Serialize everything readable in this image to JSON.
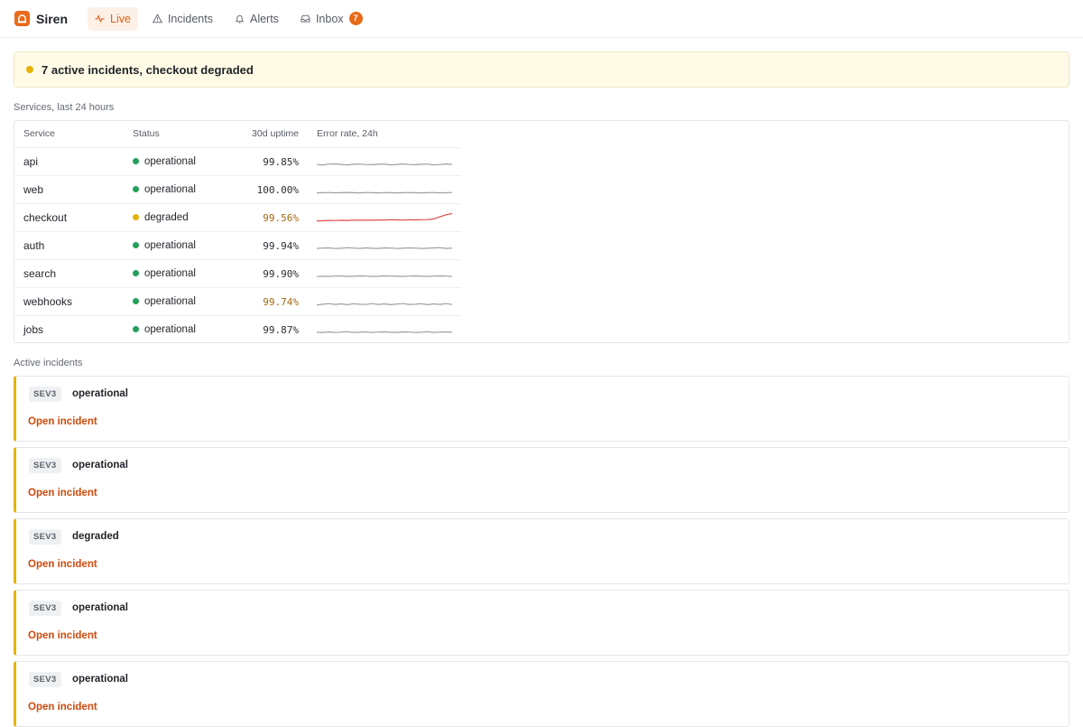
{
  "app": {
    "name": "Siren"
  },
  "nav": [
    {
      "label": "Live",
      "icon": "pulse-icon",
      "active": true
    },
    {
      "label": "Incidents",
      "icon": "warning-icon",
      "active": false
    },
    {
      "label": "Alerts",
      "icon": "bell-icon",
      "active": false
    },
    {
      "label": "Inbox",
      "icon": "inbox-icon",
      "active": false,
      "badge": "7"
    }
  ],
  "banner": {
    "text": "7 active incidents, checkout degraded",
    "color": "#e5b409"
  },
  "services": {
    "section_label": "Services, last 24 hours",
    "columns": [
      "Service",
      "Status",
      "30d uptime",
      "Error rate, 24h"
    ],
    "rows": [
      {
        "name": "api",
        "status": "operational",
        "uptime": "99.85%",
        "warn": false,
        "spark": [
          0.32,
          0.3,
          0.35,
          0.36,
          0.33,
          0.3,
          0.34,
          0.35,
          0.32,
          0.31,
          0.34,
          0.35,
          0.3,
          0.33,
          0.36,
          0.32,
          0.31,
          0.34,
          0.35,
          0.3,
          0.32,
          0.36,
          0.33
        ]
      },
      {
        "name": "web",
        "status": "operational",
        "uptime": "100.00%",
        "warn": false,
        "spark": [
          0.3,
          0.31,
          0.32,
          0.3,
          0.31,
          0.33,
          0.31,
          0.3,
          0.32,
          0.31,
          0.3,
          0.32,
          0.31,
          0.3,
          0.31,
          0.32,
          0.31,
          0.3,
          0.31,
          0.32,
          0.3,
          0.31,
          0.32
        ]
      },
      {
        "name": "checkout",
        "status": "degraded",
        "uptime": "99.56%",
        "warn": true,
        "spark": [
          0.3,
          0.31,
          0.33,
          0.32,
          0.34,
          0.33,
          0.35,
          0.34,
          0.35,
          0.34,
          0.36,
          0.35,
          0.37,
          0.36,
          0.35,
          0.37,
          0.36,
          0.37,
          0.38,
          0.42,
          0.55,
          0.68,
          0.75
        ]
      },
      {
        "name": "auth",
        "status": "operational",
        "uptime": "99.94%",
        "warn": false,
        "spark": [
          0.33,
          0.35,
          0.36,
          0.32,
          0.34,
          0.37,
          0.35,
          0.33,
          0.36,
          0.34,
          0.33,
          0.36,
          0.35,
          0.32,
          0.34,
          0.36,
          0.35,
          0.33,
          0.34,
          0.36,
          0.37,
          0.33,
          0.35
        ]
      },
      {
        "name": "search",
        "status": "operational",
        "uptime": "99.90%",
        "warn": false,
        "spark": [
          0.32,
          0.34,
          0.33,
          0.35,
          0.36,
          0.33,
          0.34,
          0.36,
          0.35,
          0.33,
          0.34,
          0.36,
          0.35,
          0.34,
          0.33,
          0.35,
          0.36,
          0.34,
          0.33,
          0.35,
          0.36,
          0.35,
          0.33
        ]
      },
      {
        "name": "webhooks",
        "status": "operational",
        "uptime": "99.74%",
        "warn": true,
        "spark": [
          0.3,
          0.34,
          0.38,
          0.33,
          0.36,
          0.31,
          0.37,
          0.34,
          0.32,
          0.38,
          0.33,
          0.36,
          0.31,
          0.35,
          0.38,
          0.33,
          0.34,
          0.37,
          0.31,
          0.36,
          0.33,
          0.38,
          0.32
        ]
      },
      {
        "name": "jobs",
        "status": "operational",
        "uptime": "99.87%",
        "warn": false,
        "spark": [
          0.34,
          0.33,
          0.36,
          0.32,
          0.35,
          0.37,
          0.33,
          0.34,
          0.36,
          0.32,
          0.35,
          0.36,
          0.34,
          0.33,
          0.36,
          0.35,
          0.32,
          0.34,
          0.37,
          0.33,
          0.35,
          0.36,
          0.34
        ]
      }
    ]
  },
  "incidents": {
    "section_label": "Active incidents",
    "link_label": "Open incident",
    "items": [
      {
        "sev": "SEV3",
        "title": "operational"
      },
      {
        "sev": "SEV3",
        "title": "operational"
      },
      {
        "sev": "SEV3",
        "title": "degraded"
      },
      {
        "sev": "SEV3",
        "title": "operational"
      },
      {
        "sev": "SEV3",
        "title": "operational"
      }
    ]
  },
  "colors": {
    "accent": "#ea6a1a",
    "operational": "#22a05a",
    "degraded": "#e5b409",
    "spark_normal": "#9aa0a6",
    "spark_alert": "#e04848"
  }
}
